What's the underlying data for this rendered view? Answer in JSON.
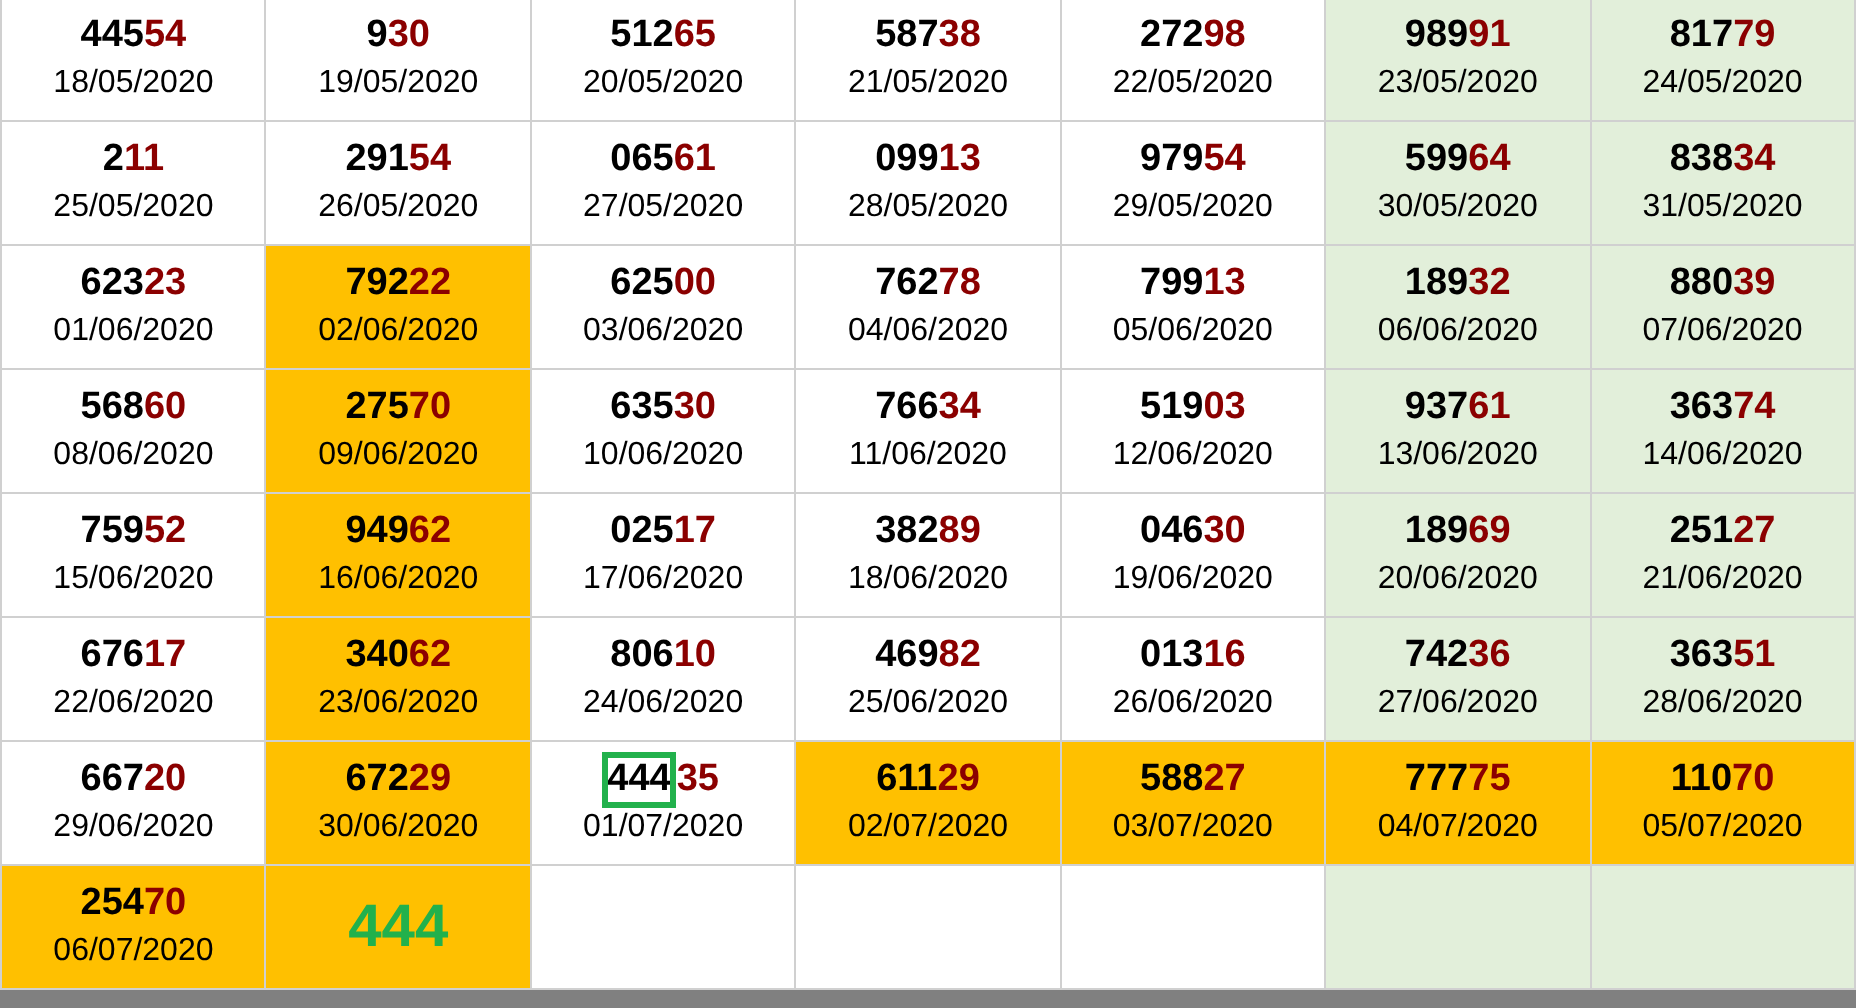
{
  "rows": [
    [
      {
        "kind": "result",
        "head": "445",
        "tail": "54",
        "date": "18/05/2020",
        "highlighted": false,
        "weekend": false,
        "boxed": false
      },
      {
        "kind": "result",
        "head": "9",
        "tail": "30",
        "date": "19/05/2020",
        "highlighted": false,
        "weekend": false,
        "boxed": false
      },
      {
        "kind": "result",
        "head": "512",
        "tail": "65",
        "date": "20/05/2020",
        "highlighted": false,
        "weekend": false,
        "boxed": false
      },
      {
        "kind": "result",
        "head": "587",
        "tail": "38",
        "date": "21/05/2020",
        "highlighted": false,
        "weekend": false,
        "boxed": false
      },
      {
        "kind": "result",
        "head": "272",
        "tail": "98",
        "date": "22/05/2020",
        "highlighted": false,
        "weekend": false,
        "boxed": false
      },
      {
        "kind": "result",
        "head": "989",
        "tail": "91",
        "date": "23/05/2020",
        "highlighted": false,
        "weekend": true,
        "boxed": false
      },
      {
        "kind": "result",
        "head": "817",
        "tail": "79",
        "date": "24/05/2020",
        "highlighted": false,
        "weekend": true,
        "boxed": false
      }
    ],
    [
      {
        "kind": "result",
        "head": "2",
        "tail": "11",
        "date": "25/05/2020",
        "highlighted": false,
        "weekend": false,
        "boxed": false
      },
      {
        "kind": "result",
        "head": "291",
        "tail": "54",
        "date": "26/05/2020",
        "highlighted": false,
        "weekend": false,
        "boxed": false
      },
      {
        "kind": "result",
        "head": "065",
        "tail": "61",
        "date": "27/05/2020",
        "highlighted": false,
        "weekend": false,
        "boxed": false
      },
      {
        "kind": "result",
        "head": "099",
        "tail": "13",
        "date": "28/05/2020",
        "highlighted": false,
        "weekend": false,
        "boxed": false
      },
      {
        "kind": "result",
        "head": "979",
        "tail": "54",
        "date": "29/05/2020",
        "highlighted": false,
        "weekend": false,
        "boxed": false
      },
      {
        "kind": "result",
        "head": "599",
        "tail": "64",
        "date": "30/05/2020",
        "highlighted": false,
        "weekend": true,
        "boxed": false
      },
      {
        "kind": "result",
        "head": "838",
        "tail": "34",
        "date": "31/05/2020",
        "highlighted": false,
        "weekend": true,
        "boxed": false
      }
    ],
    [
      {
        "kind": "result",
        "head": "623",
        "tail": "23",
        "date": "01/06/2020",
        "highlighted": false,
        "weekend": false,
        "boxed": false
      },
      {
        "kind": "result",
        "head": "792",
        "tail": "22",
        "date": "02/06/2020",
        "highlighted": true,
        "boxed": false
      },
      {
        "kind": "result",
        "head": "625",
        "tail": "00",
        "date": "03/06/2020",
        "highlighted": false,
        "weekend": false,
        "boxed": false
      },
      {
        "kind": "result",
        "head": "762",
        "tail": "78",
        "date": "04/06/2020",
        "highlighted": false,
        "weekend": false,
        "boxed": false
      },
      {
        "kind": "result",
        "head": "799",
        "tail": "13",
        "date": "05/06/2020",
        "highlighted": false,
        "weekend": false,
        "boxed": false
      },
      {
        "kind": "result",
        "head": "189",
        "tail": "32",
        "date": "06/06/2020",
        "highlighted": false,
        "weekend": true,
        "boxed": false
      },
      {
        "kind": "result",
        "head": "880",
        "tail": "39",
        "date": "07/06/2020",
        "highlighted": false,
        "weekend": true,
        "boxed": false
      }
    ],
    [
      {
        "kind": "result",
        "head": "568",
        "tail": "60",
        "date": "08/06/2020",
        "highlighted": false,
        "weekend": false,
        "boxed": false
      },
      {
        "kind": "result",
        "head": "275",
        "tail": "70",
        "date": "09/06/2020",
        "highlighted": true,
        "boxed": false
      },
      {
        "kind": "result",
        "head": "635",
        "tail": "30",
        "date": "10/06/2020",
        "highlighted": false,
        "weekend": false,
        "boxed": false
      },
      {
        "kind": "result",
        "head": "766",
        "tail": "34",
        "date": "11/06/2020",
        "highlighted": false,
        "weekend": false,
        "boxed": false
      },
      {
        "kind": "result",
        "head": "519",
        "tail": "03",
        "date": "12/06/2020",
        "highlighted": false,
        "weekend": false,
        "boxed": false
      },
      {
        "kind": "result",
        "head": "937",
        "tail": "61",
        "date": "13/06/2020",
        "highlighted": false,
        "weekend": true,
        "boxed": false
      },
      {
        "kind": "result",
        "head": "363",
        "tail": "74",
        "date": "14/06/2020",
        "highlighted": false,
        "weekend": true,
        "boxed": false
      }
    ],
    [
      {
        "kind": "result",
        "head": "759",
        "tail": "52",
        "date": "15/06/2020",
        "highlighted": false,
        "weekend": false,
        "boxed": false
      },
      {
        "kind": "result",
        "head": "949",
        "tail": "62",
        "date": "16/06/2020",
        "highlighted": true,
        "boxed": false
      },
      {
        "kind": "result",
        "head": "025",
        "tail": "17",
        "date": "17/06/2020",
        "highlighted": false,
        "weekend": false,
        "boxed": false
      },
      {
        "kind": "result",
        "head": "382",
        "tail": "89",
        "date": "18/06/2020",
        "highlighted": false,
        "weekend": false,
        "boxed": false
      },
      {
        "kind": "result",
        "head": "046",
        "tail": "30",
        "date": "19/06/2020",
        "highlighted": false,
        "weekend": false,
        "boxed": false
      },
      {
        "kind": "result",
        "head": "189",
        "tail": "69",
        "date": "20/06/2020",
        "highlighted": false,
        "weekend": true,
        "boxed": false
      },
      {
        "kind": "result",
        "head": "251",
        "tail": "27",
        "date": "21/06/2020",
        "highlighted": false,
        "weekend": true,
        "boxed": false
      }
    ],
    [
      {
        "kind": "result",
        "head": "676",
        "tail": "17",
        "date": "22/06/2020",
        "highlighted": false,
        "weekend": false,
        "boxed": false
      },
      {
        "kind": "result",
        "head": "340",
        "tail": "62",
        "date": "23/06/2020",
        "highlighted": true,
        "boxed": false
      },
      {
        "kind": "result",
        "head": "806",
        "tail": "10",
        "date": "24/06/2020",
        "highlighted": false,
        "weekend": false,
        "boxed": false
      },
      {
        "kind": "result",
        "head": "469",
        "tail": "82",
        "date": "25/06/2020",
        "highlighted": false,
        "weekend": false,
        "boxed": false
      },
      {
        "kind": "result",
        "head": "013",
        "tail": "16",
        "date": "26/06/2020",
        "highlighted": false,
        "weekend": false,
        "boxed": false
      },
      {
        "kind": "result",
        "head": "742",
        "tail": "36",
        "date": "27/06/2020",
        "highlighted": false,
        "weekend": true,
        "boxed": false
      },
      {
        "kind": "result",
        "head": "363",
        "tail": "51",
        "date": "28/06/2020",
        "highlighted": false,
        "weekend": true,
        "boxed": false
      }
    ],
    [
      {
        "kind": "result",
        "head": "667",
        "tail": "20",
        "date": "29/06/2020",
        "highlighted": false,
        "weekend": false,
        "boxed": false
      },
      {
        "kind": "result",
        "head": "672",
        "tail": "29",
        "date": "30/06/2020",
        "highlighted": true,
        "boxed": false
      },
      {
        "kind": "result",
        "head": "444",
        "tail": "35",
        "date": "01/07/2020",
        "highlighted": false,
        "weekend": false,
        "boxed": true
      },
      {
        "kind": "result",
        "head": "611",
        "tail": "29",
        "date": "02/07/2020",
        "highlighted": true,
        "boxed": false
      },
      {
        "kind": "result",
        "head": "588",
        "tail": "27",
        "date": "03/07/2020",
        "highlighted": true,
        "boxed": false
      },
      {
        "kind": "result",
        "head": "777",
        "tail": "75",
        "date": "04/07/2020",
        "highlighted": true,
        "boxed": false
      },
      {
        "kind": "result",
        "head": "110",
        "tail": "70",
        "date": "05/07/2020",
        "highlighted": true,
        "boxed": false
      }
    ],
    [
      {
        "kind": "result",
        "head": "254",
        "tail": "70",
        "date": "06/07/2020",
        "highlighted": true,
        "boxed": false
      },
      {
        "kind": "note",
        "text": "444",
        "highlighted": true
      },
      {
        "kind": "empty",
        "highlighted": false,
        "weekend": false
      },
      {
        "kind": "empty",
        "highlighted": false,
        "weekend": false
      },
      {
        "kind": "empty",
        "highlighted": false,
        "weekend": false
      },
      {
        "kind": "empty",
        "highlighted": false,
        "weekend": true
      },
      {
        "kind": "empty",
        "highlighted": false,
        "weekend": true
      }
    ]
  ]
}
